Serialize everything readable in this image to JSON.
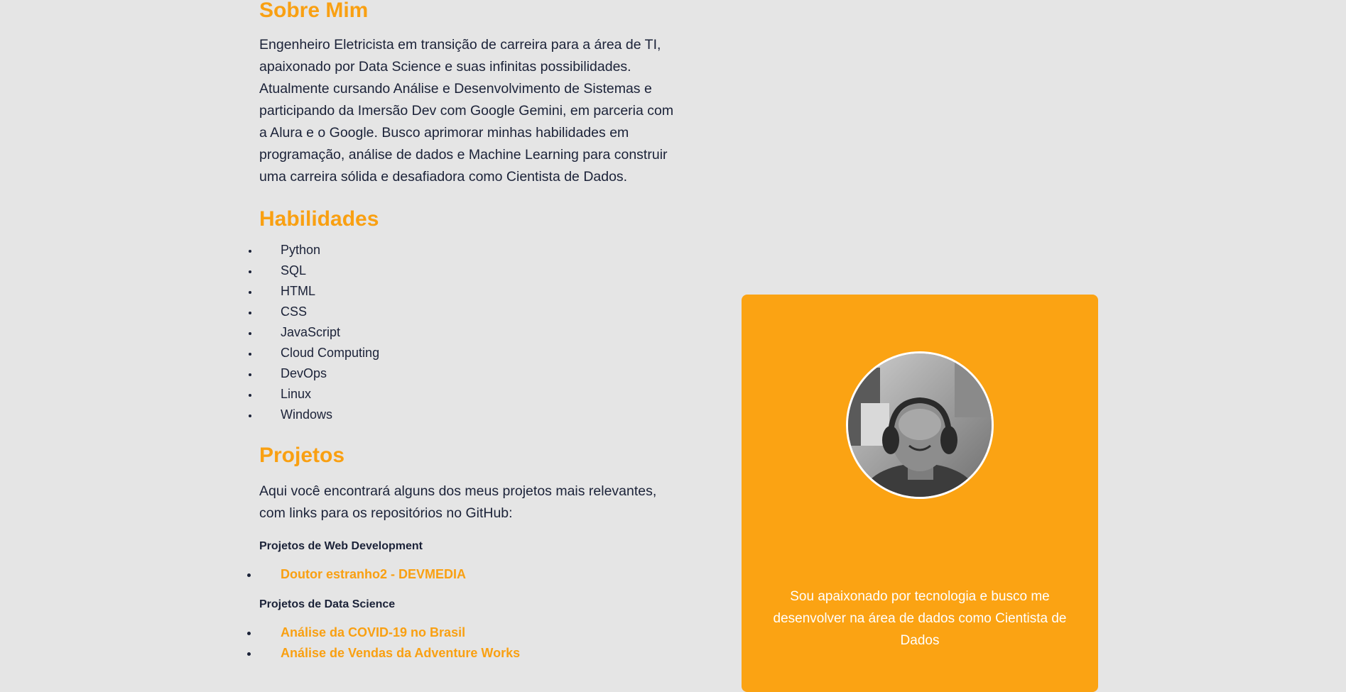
{
  "about": {
    "title": "Sobre Mim",
    "text": "Engenheiro Eletricista em transição de carreira para a área de TI, apaixonado por Data Science e suas infinitas possibilidades. Atualmente cursando Análise e Desenvolvimento de Sistemas e participando da Imersão Dev com Google Gemini, em parceria com a Alura e o Google. Busco aprimorar minhas habilidades em programação, análise de dados e Machine Learning para construir uma carreira sólida e desafiadora como Cientista de Dados."
  },
  "skills": {
    "title": "Habilidades",
    "items": [
      "Python",
      "SQL",
      "HTML",
      "CSS",
      "JavaScript",
      "Cloud Computing",
      "DevOps",
      "Linux",
      "Windows"
    ]
  },
  "projects": {
    "title": "Projetos",
    "intro": "Aqui você encontrará alguns dos meus projetos mais relevantes, com links para os repositórios no GitHub:",
    "web": {
      "title": "Projetos de Web Development",
      "links": [
        "Doutor estranho2 - DEVMEDIA"
      ]
    },
    "data": {
      "title": "Projetos de Data Science",
      "links": [
        "Análise da COVID-19 no Brasil",
        "Análise de Vendas da Adventure Works"
      ]
    }
  },
  "card": {
    "text": "Sou apaixonado por tecnologia e busco me desenvolver na área de dados como Cientista de Dados",
    "accent": "#fba313"
  },
  "colors": {
    "accent": "#f9a012",
    "background": "#e5e5e5",
    "text": "#1b2238"
  }
}
